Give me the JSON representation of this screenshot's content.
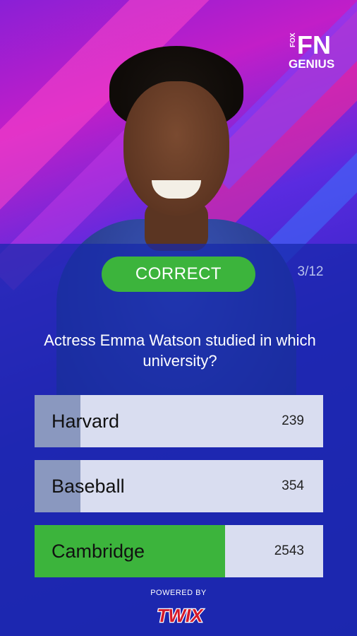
{
  "brand": {
    "logo_text_fn": "FN",
    "logo_text_fox": "FOX",
    "logo_text_genius": "GENIUS"
  },
  "quiz": {
    "status_label": "CORRECT",
    "progress": "3/12",
    "question": "Actress Emma Watson studied in which university?",
    "answers": [
      {
        "label": "Harvard",
        "count": "239",
        "fill_fraction": 0.16,
        "state": "wrong"
      },
      {
        "label": "Baseball",
        "count": "354",
        "fill_fraction": 0.16,
        "state": "wrong"
      },
      {
        "label": "Cambridge",
        "count": "2543",
        "fill_fraction": 0.66,
        "state": "correct"
      }
    ]
  },
  "footer": {
    "powered_by": "POWERED BY",
    "sponsor": "TWIX"
  },
  "colors": {
    "correct": "#3cb43c",
    "wrong_fill": "#8a98bf",
    "answer_bg": "#d9ddf0",
    "panel": "#1628aa"
  }
}
